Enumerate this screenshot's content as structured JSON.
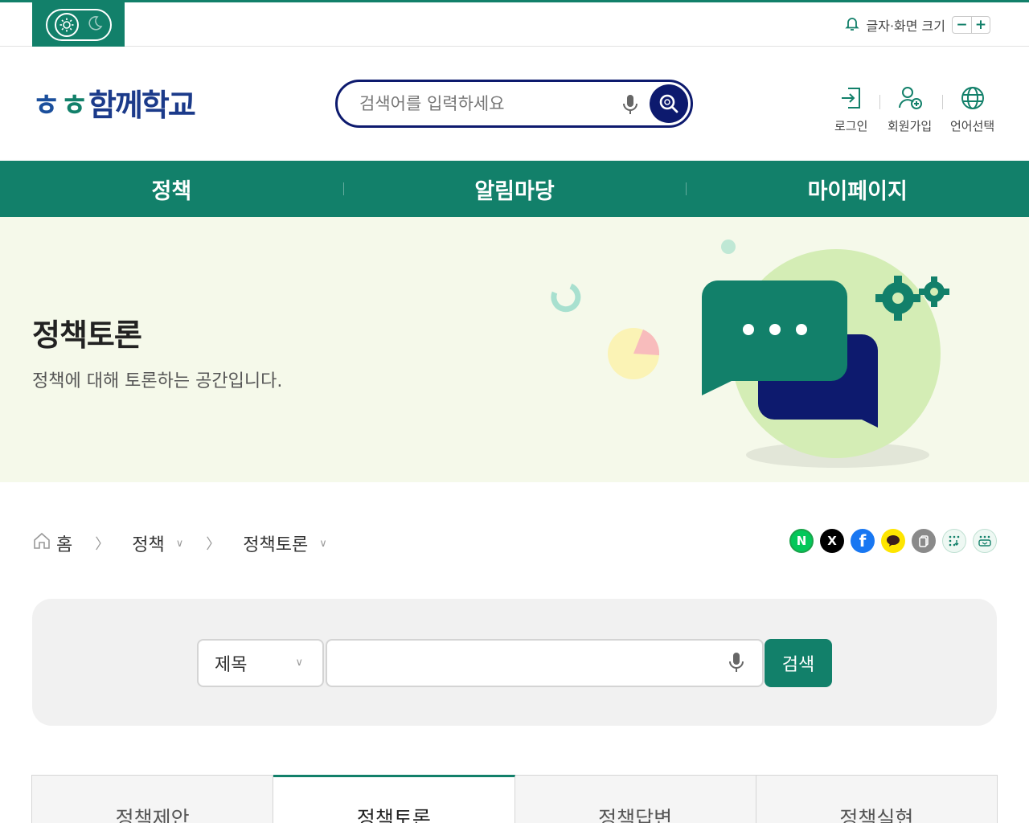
{
  "topbar": {
    "font_size_label": "글자·화면 크기",
    "decrease": "−",
    "increase": "+"
  },
  "header": {
    "logo_parts": [
      "ㅎ",
      "ㅎ",
      "함께학교"
    ],
    "search_placeholder": "검색어를 입력하세요",
    "utils": [
      {
        "label": "로그인",
        "icon": "login-icon"
      },
      {
        "label": "회원가입",
        "icon": "user-add-icon"
      },
      {
        "label": "언어선택",
        "icon": "globe-icon"
      }
    ]
  },
  "gnb": {
    "items": [
      "정책",
      "알림마당",
      "마이페이지"
    ]
  },
  "hero": {
    "title": "정책토론",
    "description": "정책에 대해 토론하는 공간입니다."
  },
  "breadcrumb": {
    "home": "홈",
    "level1": "정책",
    "level2": "정책토론"
  },
  "share": {
    "naver": "N",
    "x": "X",
    "facebook": "f",
    "kakao": "",
    "copy": "",
    "more1": "",
    "more2": ""
  },
  "search": {
    "select_value": "제목",
    "keyword_value": "",
    "button": "검색"
  },
  "tabs": [
    "정책제안",
    "정책토론",
    "정책답변",
    "정책실현"
  ],
  "colors": {
    "primary": "#12806a",
    "navy": "#0d1a6e",
    "hero_bg": "#f5f9ea"
  }
}
